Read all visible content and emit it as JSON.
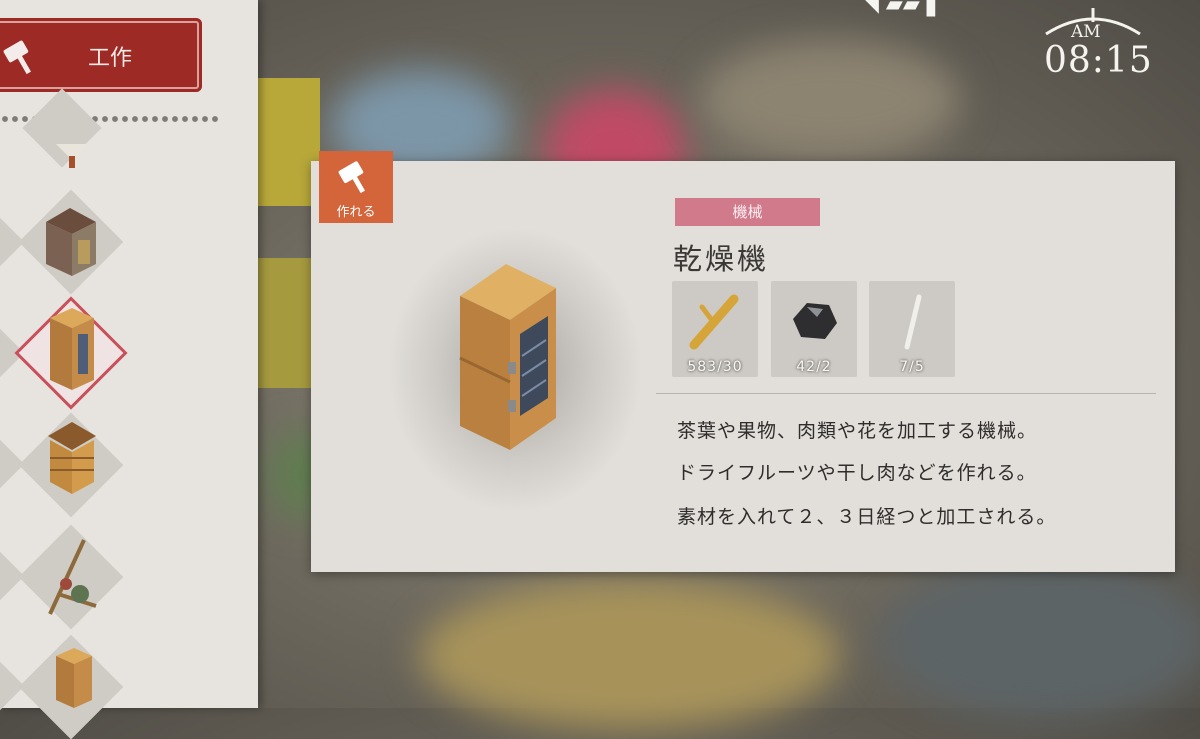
{
  "craft_menu": {
    "tab_label": "工作"
  },
  "clock": {
    "ampm": "AM",
    "time": "08:15"
  },
  "detail": {
    "craftable_label": "作れる",
    "category": "機械",
    "name": "乾燥機",
    "materials": [
      {
        "icon": "wood-branch-icon",
        "count": "583/30"
      },
      {
        "icon": "coal-icon",
        "count": "42/2"
      },
      {
        "icon": "rod-icon",
        "count": "7/5"
      }
    ],
    "description": [
      "茶葉や果物、肉類や花を加工する機械。",
      "ドライフルーツや干し肉などを作れる。",
      "素材を入れて２、３日経つと加工される。"
    ]
  }
}
